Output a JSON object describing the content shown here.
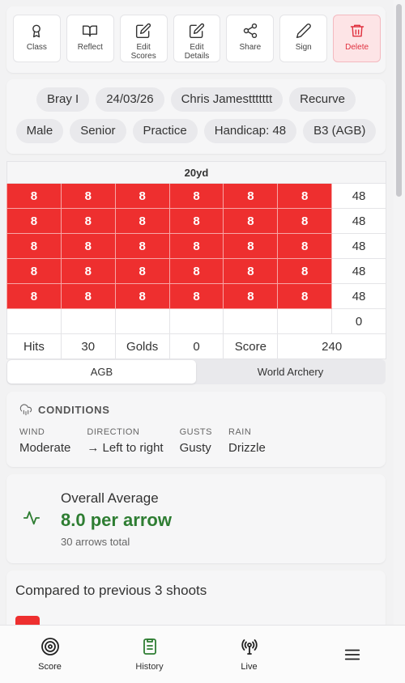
{
  "toolbar": {
    "items": [
      {
        "label": "Class",
        "icon": "award-icon"
      },
      {
        "label": "Reflect",
        "icon": "book-icon"
      },
      {
        "label": "Edit\nScores",
        "icon": "edit-icon"
      },
      {
        "label": "Edit\nDetails",
        "icon": "edit-icon"
      },
      {
        "label": "Share",
        "icon": "share-icon"
      },
      {
        "label": "Sign",
        "icon": "pencil-icon"
      },
      {
        "label": "Delete",
        "icon": "trash-icon"
      }
    ],
    "delete_color": "#e0303e"
  },
  "tags": {
    "row1": [
      "Bray I",
      "24/03/26",
      "Chris Jamesttttttt",
      "Recurve"
    ],
    "row2": [
      "Male",
      "Senior",
      "Practice",
      "Handicap: 48",
      "B3 (AGB)"
    ]
  },
  "scores": {
    "distance": "20yd",
    "ends": [
      {
        "arrows": [
          "8",
          "8",
          "8",
          "8",
          "8",
          "8"
        ],
        "total": "48"
      },
      {
        "arrows": [
          "8",
          "8",
          "8",
          "8",
          "8",
          "8"
        ],
        "total": "48"
      },
      {
        "arrows": [
          "8",
          "8",
          "8",
          "8",
          "8",
          "8"
        ],
        "total": "48"
      },
      {
        "arrows": [
          "8",
          "8",
          "8",
          "8",
          "8",
          "8"
        ],
        "total": "48"
      },
      {
        "arrows": [
          "8",
          "8",
          "8",
          "8",
          "8",
          "8"
        ],
        "total": "48"
      }
    ],
    "empty_total": "0",
    "summary": {
      "hits_label": "Hits",
      "hits": "30",
      "golds_label": "Golds",
      "golds": "0",
      "score_label": "Score",
      "score": "240"
    },
    "cell_color": "#ee2f2f"
  },
  "segment": {
    "options": [
      "AGB",
      "World Archery"
    ],
    "selected": "AGB"
  },
  "conditions": {
    "title": "CONDITIONS",
    "items": [
      {
        "key": "WIND",
        "value": "Moderate"
      },
      {
        "key": "DIRECTION",
        "value": "→ Left to right"
      },
      {
        "key": "GUSTS",
        "value": "Gusty"
      },
      {
        "key": "RAIN",
        "value": "Drizzle"
      }
    ]
  },
  "average": {
    "title": "Overall Average",
    "value": "8.0 per arrow",
    "sub": "30 arrows total",
    "color": "#2e7d32"
  },
  "compared": {
    "title": "Compared to previous 3 shoots"
  },
  "nav": {
    "items": [
      {
        "label": "Score",
        "icon": "target-icon"
      },
      {
        "label": "History",
        "icon": "clipboard-icon"
      },
      {
        "label": "Live",
        "icon": "broadcast-icon"
      }
    ],
    "active": "History",
    "menu_icon": "menu-icon"
  }
}
